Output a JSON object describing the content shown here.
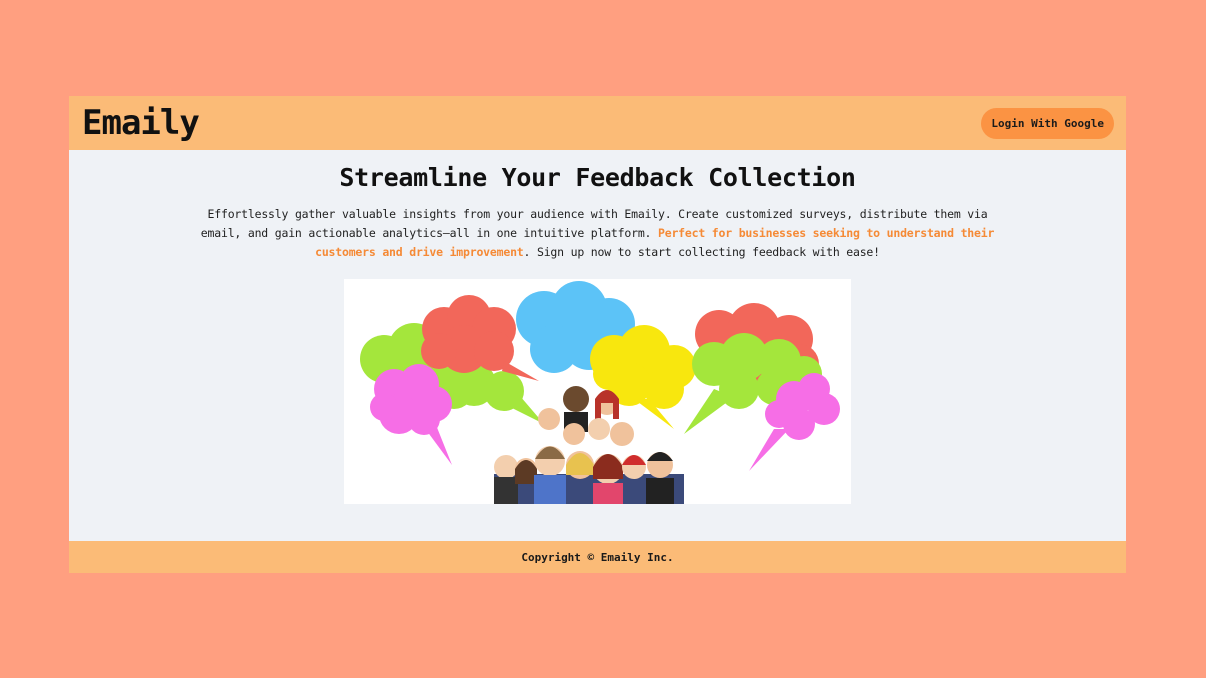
{
  "header": {
    "brand": "Emaily",
    "login_label": "Login With Google"
  },
  "hero": {
    "title": "Streamline Your Feedback Collection",
    "description_part1": "Effortlessly gather valuable insights from your audience with Emaily. Create customized surveys, distribute them via email, and gain actionable analytics—all in one intuitive platform. ",
    "description_highlight": "Perfect for businesses seeking to understand their customers and drive improvement",
    "description_part2": ". Sign up now to start collecting feedback with ease!"
  },
  "footer": {
    "copyright": "Copyright © Emaily Inc."
  },
  "colors": {
    "page_background": "#ff9f80",
    "header_background": "#fbbb77",
    "button_background": "#fb9343",
    "highlight_text": "#f58a36",
    "content_background": "#eff2f6"
  },
  "icons": {
    "hero_image": "speech-bubbles-crowd-illustration"
  }
}
